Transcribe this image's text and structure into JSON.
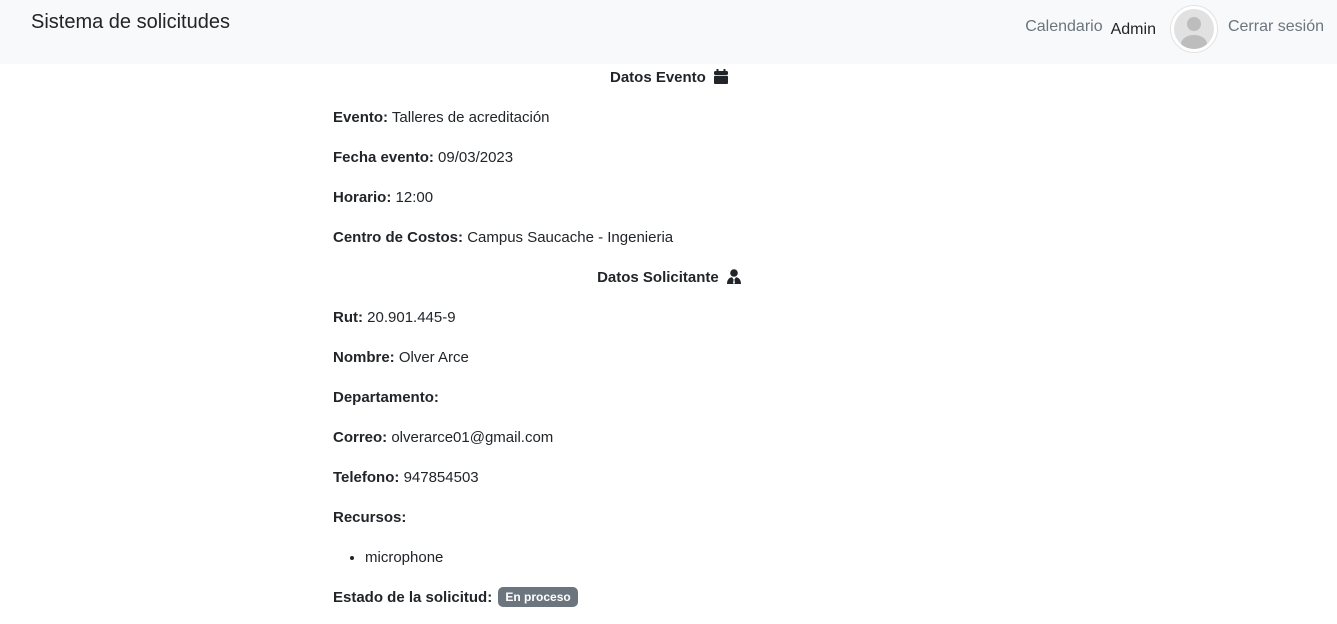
{
  "navbar": {
    "brand": "Sistema de solicitudes",
    "calendar_link": "Calendario",
    "user_name": "Admin",
    "logout_link": "Cerrar sesión"
  },
  "event_section": {
    "title": "Datos Evento",
    "icon": "calendar-icon",
    "fields": {
      "event_label": "Evento:",
      "event_value": "Talleres de acreditación",
      "date_label": "Fecha evento:",
      "date_value": "09/03/2023",
      "time_label": "Horario:",
      "time_value": "12:00",
      "cost_center_label": "Centro de Costos:",
      "cost_center_value": "Campus Saucache - Ingenieria"
    }
  },
  "requester_section": {
    "title": "Datos Solicitante",
    "icon": "user-tie-icon",
    "fields": {
      "rut_label": "Rut:",
      "rut_value": "20.901.445-9",
      "name_label": "Nombre:",
      "name_value": "Olver Arce",
      "department_label": "Departamento:",
      "department_value": "",
      "email_label": "Correo:",
      "email_value": "olverarce01@gmail.com",
      "phone_label": "Telefono:",
      "phone_value": "947854503",
      "resources_label": "Recursos:",
      "resources": [
        "microphone"
      ],
      "status_label": "Estado de la solicitud:",
      "status_value": "En proceso"
    }
  },
  "colors": {
    "navbar_bg": "#f8f9fa",
    "badge_bg": "#6c757d",
    "text": "#212529",
    "muted_link": "#6c757d"
  }
}
